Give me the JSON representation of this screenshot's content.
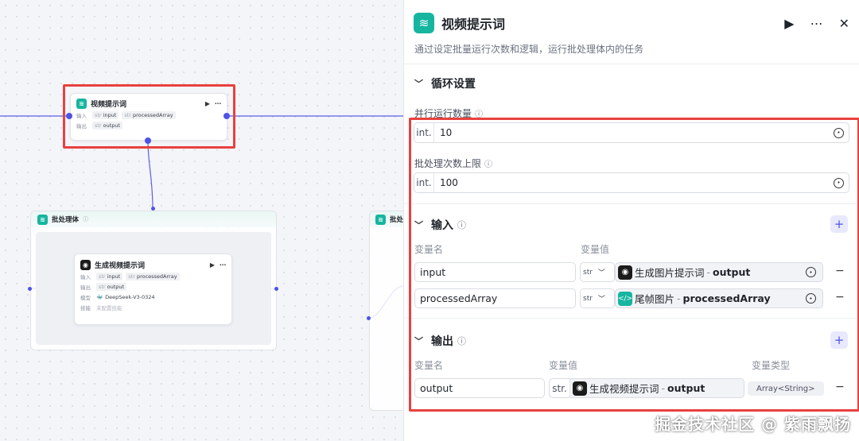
{
  "canvas": {
    "main_node": {
      "title": "视频提示词",
      "input_label": "输入",
      "output_label": "输出",
      "type_abbr": "str",
      "inputs": [
        "input",
        "processedArray"
      ],
      "outputs": [
        "output"
      ]
    },
    "batch_group": {
      "title": "批处理体",
      "partial_title": "批处"
    },
    "inner_node": {
      "title": "生成视频提示词",
      "input_label": "输入",
      "output_label": "输出",
      "model_label": "模型",
      "skill_label": "技能",
      "type_abbr": "str",
      "inputs": [
        "input",
        "processedArray"
      ],
      "outputs": [
        "output"
      ],
      "model": "DeepSeek-V3-0324",
      "skill": "未配置技能"
    }
  },
  "panel": {
    "title": "视频提示词",
    "description": "通过设定批量运行次数和逻辑，运行批处理体内的任务",
    "loop_section": {
      "title": "循环设置",
      "parallel_label": "并行运行数量",
      "parallel_type": "int.",
      "parallel_value": "10",
      "batch_limit_label": "批处理次数上限",
      "batch_limit_type": "int.",
      "batch_limit_value": "100"
    },
    "input_section": {
      "title": "输入",
      "col_name": "变量名",
      "col_value": "变量值",
      "rows": [
        {
          "name": "input",
          "type": "str",
          "ref_node": "生成图片提示词",
          "ref_field": "output"
        },
        {
          "name": "processedArray",
          "type": "str",
          "ref_node": "尾帧图片",
          "ref_field": "processedArray"
        }
      ]
    },
    "output_section": {
      "title": "输出",
      "col_name": "变量名",
      "col_value": "变量值",
      "col_type": "变量类型",
      "rows": [
        {
          "name": "output",
          "type": "str.",
          "ref_node": "生成视频提示词",
          "ref_field": "output",
          "var_type": "Array<String>"
        }
      ]
    },
    "separator": "-",
    "plus": "+",
    "minus": "−"
  },
  "watermark": "掘金技术社区 @ 紫雨飘扬",
  "colors": {
    "accent": "#4d53e8",
    "highlight": "#e8413f",
    "node_icon": "#16b5a0"
  }
}
